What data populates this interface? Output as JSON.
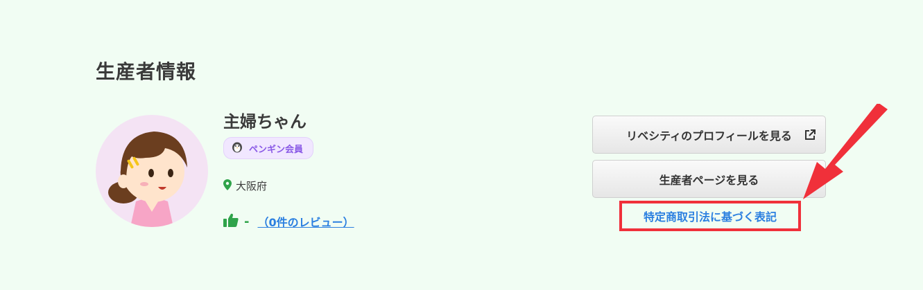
{
  "section": {
    "title": "生産者情報"
  },
  "producer": {
    "name": "主婦ちゃん",
    "badge_label": "ペンギン会員",
    "location": "大阪府",
    "rating": "-",
    "review_link": "（0件のレビュー）"
  },
  "actions": {
    "profile_button": "リベシティのプロフィールを見る",
    "producer_page_button": "生産者ページを見る",
    "legal_link": "特定商取引法に基づく表記"
  },
  "icons": {
    "avatar": "avatar-illustration",
    "badge": "penguin-icon",
    "location": "map-pin-icon",
    "rating": "thumbs-up-icon",
    "external": "external-link-icon",
    "annotation": "red-arrow-annotation"
  },
  "colors": {
    "background": "#f1fdf3",
    "link": "#2b7fe0",
    "badge_text": "#8a5ae6",
    "rating": "#2fa34a",
    "highlight": "#f0303a"
  }
}
